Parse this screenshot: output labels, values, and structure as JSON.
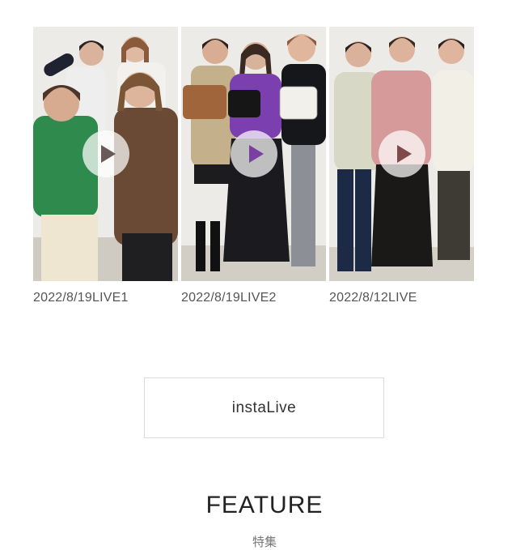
{
  "videos": [
    {
      "caption": "2022/8/19LIVE1",
      "play_icon": "play-icon",
      "play_color": "#6a5a57"
    },
    {
      "caption": "2022/8/19LIVE2",
      "play_icon": "play-icon",
      "play_color": "#7a3fa0"
    },
    {
      "caption": "2022/8/12LIVE",
      "play_icon": "play-icon",
      "play_color": "#7e4b4a"
    }
  ],
  "insta_button": {
    "label": "instaLive"
  },
  "feature": {
    "title": "FEATURE",
    "subtitle": "特集"
  }
}
